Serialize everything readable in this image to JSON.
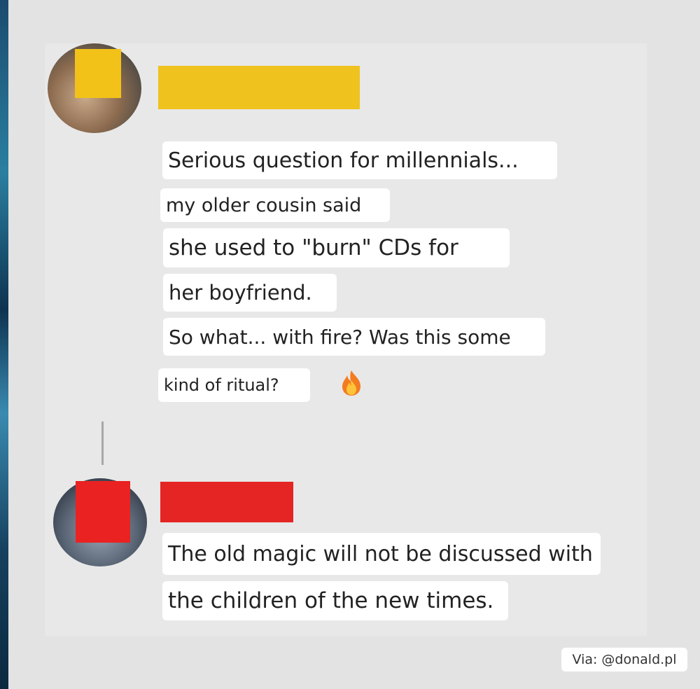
{
  "post": {
    "author_avatar_icon": "user-avatar-icon",
    "messages": [
      "Serious question for millennials...",
      "my older cousin said",
      "she used to \"burn\" CDs for",
      "her boyfriend.",
      "So what... with fire? Was this some",
      "kind of ritual?"
    ],
    "emoji": "🔥"
  },
  "reply": {
    "author_avatar_icon": "user-avatar-icon",
    "messages": [
      "The old magic will not be discussed with",
      "the children of the new times."
    ]
  },
  "credit": "Via: @donald.pl",
  "colors": {
    "background": "#e3e3e3",
    "card": "#e8e8e8",
    "censor_yellow": "#f0c21d",
    "censor_red": "#e52424",
    "bubble": "#ffffff",
    "text": "#222222"
  }
}
